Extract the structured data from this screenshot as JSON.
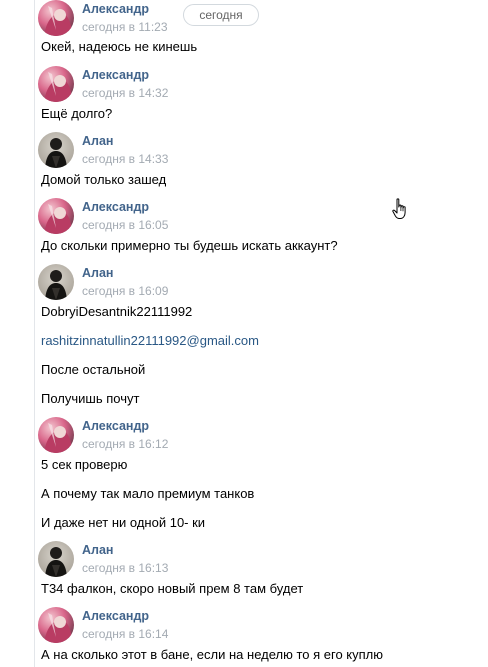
{
  "date_chip": "сегодня",
  "icons": {
    "pointer": "hand-pointer-cursor"
  },
  "colors": {
    "author": "#42648b",
    "time": "#a3aab2",
    "link": "#2a5885"
  },
  "messages": [
    {
      "author": "Александр",
      "time": "сегодня в 11:23",
      "lines": [
        "Окей, надеюсь не кинешь"
      ]
    },
    {
      "author": "Александр",
      "time": "сегодня в 14:32",
      "lines": [
        "Ещё долго?"
      ]
    },
    {
      "author": "Алан",
      "time": "сегодня в 14:33",
      "lines": [
        "Домой только зашед"
      ]
    },
    {
      "author": "Александр",
      "time": "сегодня в 16:05",
      "lines": [
        "До скольки примерно ты будешь искать аккаунт?"
      ]
    },
    {
      "author": "Алан",
      "time": "сегодня в 16:09",
      "lines": [
        "DobryiDesantnik22111992",
        "rashitzinnatullin22111992@gmail.com",
        "После остальной",
        "Получишь почут"
      ]
    },
    {
      "author": "Александр",
      "time": "сегодня в 16:12",
      "lines": [
        "5 сек проверю",
        "А почему так мало премиум танков",
        "И даже нет ни одной 10- ки"
      ]
    },
    {
      "author": "Алан",
      "time": "сегодня в 16:13",
      "lines": [
        "Т34 фалкон, скоро новый прем 8 там будет"
      ]
    },
    {
      "author": "Александр",
      "time": "сегодня в 16:14",
      "lines": [
        "А на сколько этот в бане, если на неделю то я его куплю"
      ]
    }
  ]
}
